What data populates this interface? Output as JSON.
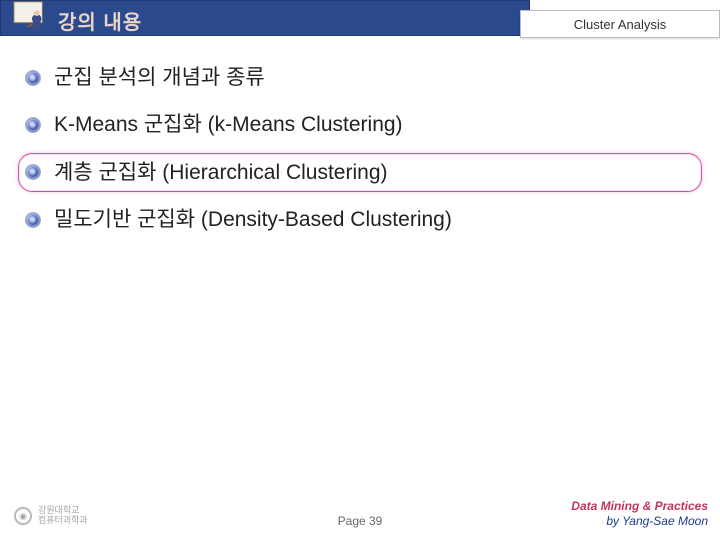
{
  "header": {
    "title": "강의 내용",
    "topic": "Cluster Analysis"
  },
  "bullets": {
    "b1": "군집 분석의 개념과 종류",
    "b2": "K-Means 군집화 (k-Means Clustering)",
    "b3": "계층 군집화 (Hierarchical Clustering)",
    "b4": "밀도기반 군집화 (Density-Based Clustering)"
  },
  "footer": {
    "page": "Page 39",
    "line1": "Data Mining & Practices",
    "line2": "by Yang-Sae Moon",
    "uni1": "강원대학교",
    "uni2": "컴퓨터과학과"
  }
}
